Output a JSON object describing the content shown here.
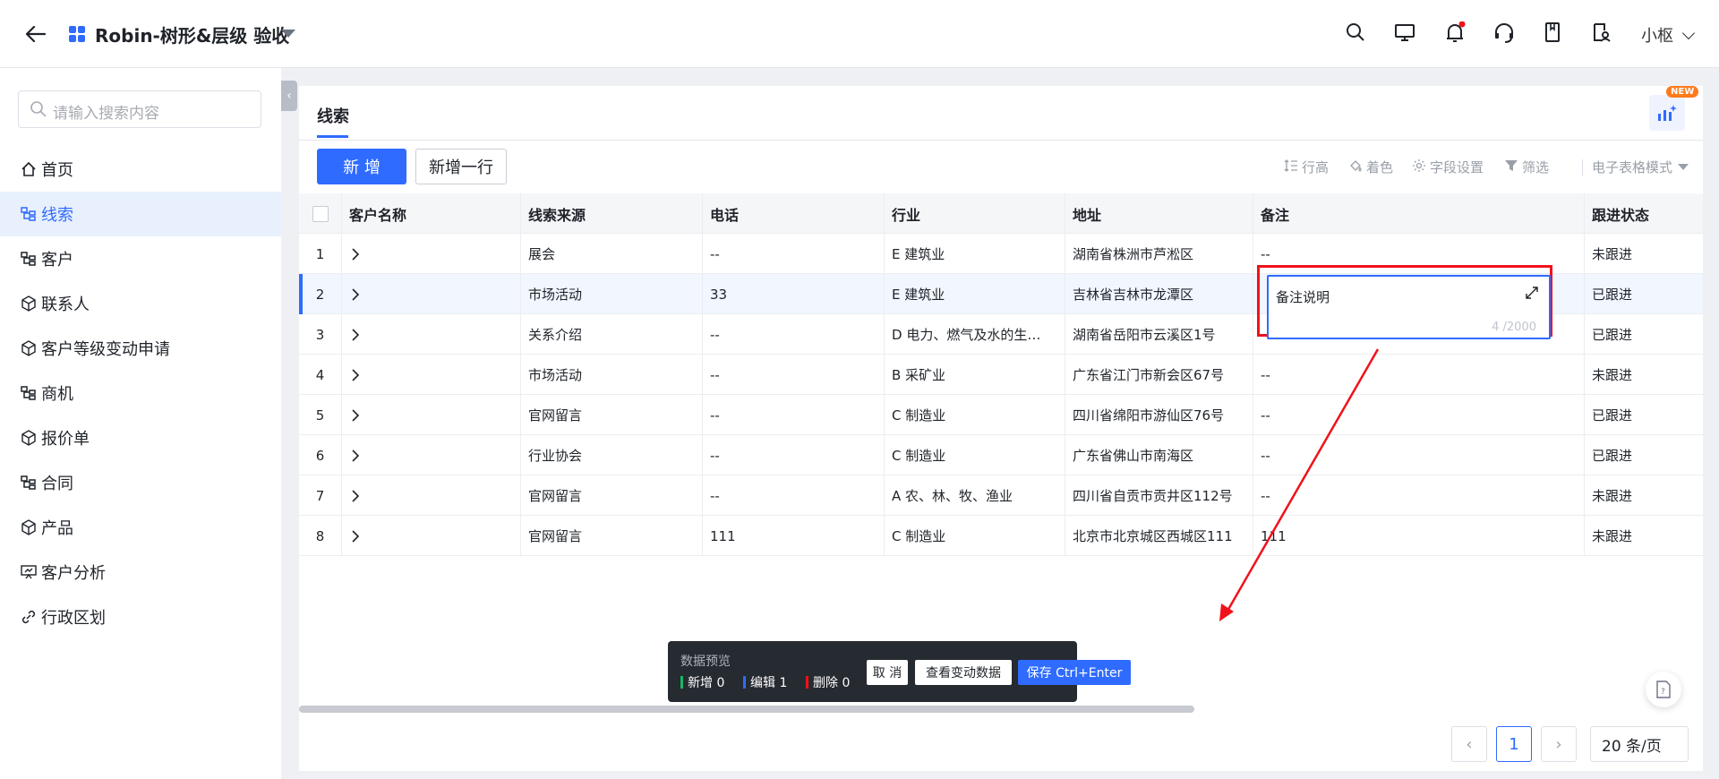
{
  "app": {
    "title": "Robin-树形&层级 验收",
    "user": "小枢"
  },
  "search": {
    "placeholder": "请输入搜索内容"
  },
  "sidebar": {
    "items": [
      {
        "label": "首页",
        "icon": "home-icon"
      },
      {
        "label": "线索",
        "icon": "tree-icon",
        "active": true
      },
      {
        "label": "客户",
        "icon": "tree-icon"
      },
      {
        "label": "联系人",
        "icon": "cube-icon"
      },
      {
        "label": "客户等级变动申请",
        "icon": "cube-icon"
      },
      {
        "label": "商机",
        "icon": "tree-icon"
      },
      {
        "label": "报价单",
        "icon": "cube-icon"
      },
      {
        "label": "合同",
        "icon": "tree-icon"
      },
      {
        "label": "产品",
        "icon": "cube-icon"
      },
      {
        "label": "客户分析",
        "icon": "presentation-icon"
      },
      {
        "label": "行政区划",
        "icon": "link-icon"
      }
    ]
  },
  "main": {
    "tab": "线索",
    "badge": "NEW",
    "buttons": {
      "add": "新 增",
      "add_row": "新增一行"
    },
    "toolbar": {
      "row_height": "行高",
      "color": "着色",
      "fields": "字段设置",
      "filter": "筛选",
      "mode": "电子表格模式"
    }
  },
  "table": {
    "columns": [
      "客户名称",
      "线索来源",
      "电话",
      "行业",
      "地址",
      "备注",
      "跟进状态"
    ],
    "rows": [
      {
        "no": "1",
        "source": "展会",
        "phone": "--",
        "industry": "E 建筑业",
        "address": "湖南省株洲市芦淞区",
        "note": "--",
        "status": "未跟进"
      },
      {
        "no": "2",
        "source": "市场活动",
        "phone": "33",
        "industry": "E 建筑业",
        "address": "吉林省吉林市龙潭区",
        "note": "",
        "status": "已跟进"
      },
      {
        "no": "3",
        "source": "关系介绍",
        "phone": "--",
        "industry": "D 电力、燃气及水的生…",
        "address": "湖南省岳阳市云溪区1号",
        "note": "--",
        "status": "已跟进"
      },
      {
        "no": "4",
        "source": "市场活动",
        "phone": "--",
        "industry": "B 采矿业",
        "address": "广东省江门市新会区67号",
        "note": "--",
        "status": "未跟进"
      },
      {
        "no": "5",
        "source": "官网留言",
        "phone": "--",
        "industry": "C 制造业",
        "address": "四川省绵阳市游仙区76号",
        "note": "--",
        "status": "已跟进"
      },
      {
        "no": "6",
        "source": "行业协会",
        "phone": "--",
        "industry": "C 制造业",
        "address": "广东省佛山市南海区",
        "note": "--",
        "status": "已跟进"
      },
      {
        "no": "7",
        "source": "官网留言",
        "phone": "--",
        "industry": "A 农、林、牧、渔业",
        "address": "四川省自贡市贡井区112号",
        "note": "--",
        "status": "未跟进"
      },
      {
        "no": "8",
        "source": "官网留言",
        "phone": "111",
        "industry": "C 制造业",
        "address": "北京市北京城区西城区111",
        "note": "111",
        "status": "未跟进"
      }
    ]
  },
  "editor": {
    "value": "备注说明",
    "count": "4 /2000"
  },
  "preview": {
    "title": "数据预览",
    "added": "新增 0",
    "edited": "编辑 1",
    "deleted": "删除 0",
    "cancel": "取 消",
    "view": "查看变动数据",
    "save": "保存 Ctrl+Enter"
  },
  "pager": {
    "page": "1",
    "size": "20 条/页"
  },
  "colors": {
    "accent": "#2f6bff",
    "highlight": "#f0121b",
    "add_bar": "#18b566",
    "edit_bar": "#2f6bff",
    "delete_bar": "#f0121b"
  }
}
